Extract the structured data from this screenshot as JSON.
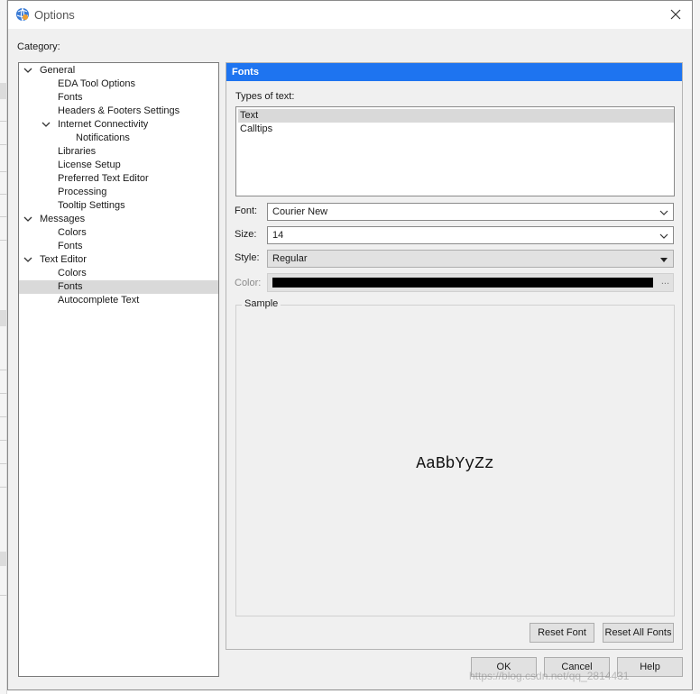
{
  "window": {
    "title": "Options",
    "close_icon": "close-icon"
  },
  "category_label": "Category:",
  "tree": {
    "general": "General",
    "eda_tool_options": "EDA Tool Options",
    "general_fonts": "Fonts",
    "headers_footers": "Headers & Footers Settings",
    "internet_connectivity": "Internet Connectivity",
    "notifications": "Notifications",
    "libraries": "Libraries",
    "license_setup": "License Setup",
    "preferred_text_editor": "Preferred Text Editor",
    "processing": "Processing",
    "tooltip_settings": "Tooltip Settings",
    "messages": "Messages",
    "messages_colors": "Colors",
    "messages_fonts": "Fonts",
    "text_editor": "Text Editor",
    "text_editor_colors": "Colors",
    "text_editor_fonts": "Fonts",
    "autocomplete_text": "Autocomplete Text"
  },
  "panel": {
    "header": "Fonts",
    "types_label": "Types of text:",
    "types": [
      "Text",
      "Calltips"
    ],
    "font_label": "Font:",
    "font_value": "Courier New",
    "size_label": "Size:",
    "size_value": "14",
    "style_label": "Style:",
    "style_value": "Regular",
    "color_label": "Color:",
    "color_value": "#000000",
    "color_more": "...",
    "sample_label": "Sample",
    "sample_text": "AaBbYyZz",
    "reset_font": "Reset Font",
    "reset_all_fonts": "Reset All Fonts"
  },
  "buttons": {
    "ok": "OK",
    "cancel": "Cancel",
    "help": "Help"
  },
  "watermark": "https://blog.csdn.net/qq_2814431",
  "colors": {
    "header_blue": "#1e74f0",
    "selection_gray": "#d9d9d9"
  }
}
